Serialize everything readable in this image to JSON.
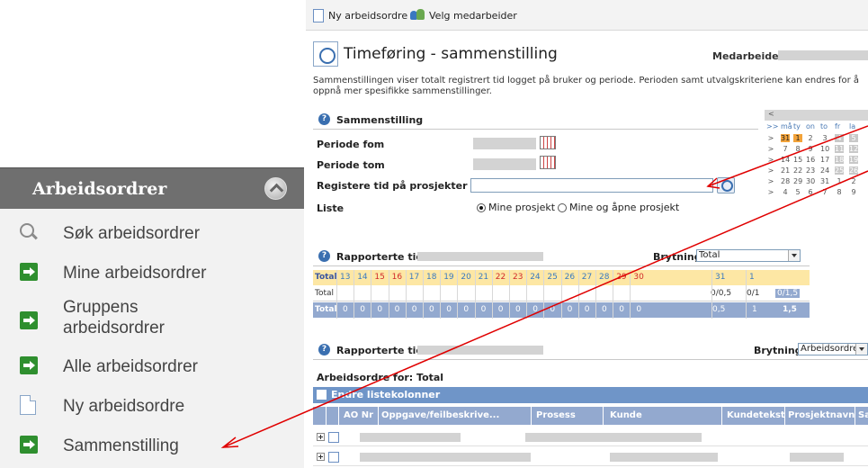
{
  "sidebar": {
    "title": "Arbeidsordrer",
    "items": [
      {
        "label": "Søk arbeidsordrer"
      },
      {
        "label": "Mine arbeidsordrer"
      },
      {
        "label": "Gruppens arbeidsordrer"
      },
      {
        "label": "Alle arbeidsordrer"
      },
      {
        "label": "Ny arbeidsordre"
      },
      {
        "label": "Sammenstilling"
      }
    ]
  },
  "toolbar": {
    "new_order": "Ny arbeidsordre",
    "choose_employee": "Velg medarbeider"
  },
  "header": {
    "title": "Timeføring - sammenstilling",
    "employee_label": "Medarbeider"
  },
  "description": "Sammenstillingen viser totalt registrert tid logget på bruker og periode. Perioden samt utvalgskriteriene kan endres for å oppnå mer spesifikke sammenstillinger.",
  "filter": {
    "section_title": "Sammenstilling",
    "period_from": "Periode fom",
    "period_to": "Periode tom",
    "register_projects": "Registere tid på prosjekter",
    "list_label": "Liste",
    "radio_mine": "Mine prosjekt",
    "radio_mine_open": "Mine og åpne prosjekt"
  },
  "calendar": {
    "nav": "<",
    "dow_prefix": ">>",
    "dow": [
      "må",
      "ty",
      "on",
      "to",
      "fr",
      "la"
    ],
    "rows": [
      [
        ">",
        "31",
        "1",
        "2",
        "3",
        "4",
        "5"
      ],
      [
        ">",
        "7",
        "8",
        "9",
        "10",
        "11",
        "12"
      ],
      [
        ">",
        "14",
        "15",
        "16",
        "17",
        "18",
        "19"
      ],
      [
        ">",
        "21",
        "22",
        "23",
        "24",
        "25",
        "26"
      ],
      [
        ">",
        "28",
        "29",
        "30",
        "31",
        "1",
        "2"
      ],
      [
        ">",
        "4",
        "5",
        "6",
        "7",
        "8",
        "9"
      ]
    ]
  },
  "reported1": {
    "title": "Rapporterte tid",
    "break_label": "Brytning",
    "break_value": "Total",
    "head_label": "Total",
    "days": [
      "13",
      "14",
      "15",
      "16",
      "17",
      "18",
      "19",
      "20",
      "21",
      "22",
      "23",
      "24",
      "25",
      "26",
      "27",
      "28",
      "29",
      "30",
      "31",
      "1"
    ],
    "row_label": "Total",
    "row_vals": [
      "0/0,5",
      "0/1",
      "0/1,5"
    ],
    "total_label": "Total",
    "total_zero": "0",
    "total_vals": [
      "0,5",
      "1",
      "1,5"
    ]
  },
  "reported2": {
    "title": "Rapporterte tid",
    "break_label": "Brytning",
    "break_value": "Arbeidsordre",
    "orders_for": "Arbeidsordre for: Total",
    "edit_columns": "Endre listekolonner",
    "columns": [
      "AO Nr",
      "Oppgave/feilbeskrive...",
      "Prosess",
      "Kunde",
      "Kundetekst",
      "Prosjektnavn",
      "Sa"
    ]
  },
  "colors": {
    "sidebar_header": "#6f6f6f",
    "sidebar_bg": "#f2f2f2",
    "table_header": "#93a9cf",
    "highlight_row": "#fde7a4",
    "annotation": "#e00000"
  }
}
